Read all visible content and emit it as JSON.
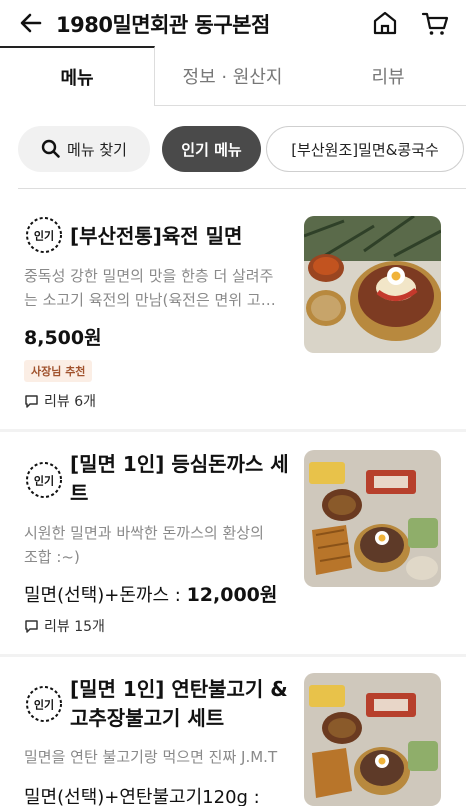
{
  "header": {
    "title": "1980밀면회관 동구본점"
  },
  "tabs": [
    {
      "label": "메뉴"
    },
    {
      "label": "정보 · 원산지"
    },
    {
      "label": "리뷰"
    }
  ],
  "chips": {
    "search": "메뉴 찾기",
    "popular": "인기 메뉴",
    "category": "[부산원조]밀면&콩국수"
  },
  "badge_text": "인기",
  "items": [
    {
      "name": "[부산전통]육전 밀면",
      "desc_line1": "중독성 강한 밀면의 맛을 한층 더 살려주",
      "desc_line2": "는 소고기 육전의 만남(육전은 면위 고…",
      "price": "8,500원",
      "rec": "사장님 추천",
      "review": "리뷰 6개"
    },
    {
      "name_line1": "[밀면 1인] 등심돈까스 세",
      "name_line2": "트",
      "desc_line1": "시원한 밀면과 바싹한 돈까스의 환상의",
      "desc_line2": "조합 :~)",
      "price_prefix": "밀면(선택)+돈까스 : ",
      "price": "12,000원",
      "review": "리뷰 15개"
    },
    {
      "name_line1": "[밀면 1인] 연탄불고기 &",
      "name_line2": "고추장불고기 세트",
      "desc_line1": "밀면을 연탄 불고기랑 먹으면 진짜 J.M.T",
      "price_prefix": "밀면(선택)+연탄불고기120g :"
    }
  ]
}
